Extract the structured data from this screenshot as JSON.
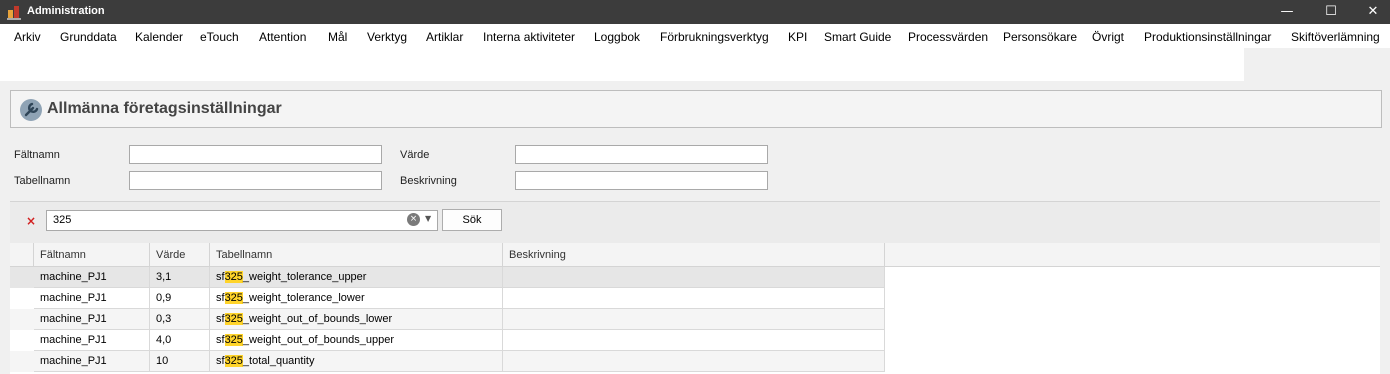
{
  "window": {
    "title": "Administration",
    "minimize_glyph": "—",
    "maximize_glyph": "☐",
    "close_glyph": "✕"
  },
  "menu": [
    "Arkiv",
    "Grunddata",
    "Kalender",
    "eTouch",
    "Attention",
    "Mål",
    "Verktyg",
    "Artiklar",
    "Interna aktiviteter",
    "Loggbok",
    "Förbrukningsverktyg",
    "KPI",
    "Smart Guide",
    "Processvärden",
    "Personsökare",
    "Övrigt",
    "Produktionsinställningar",
    "Skiftöverlämning"
  ],
  "panel": {
    "title": "Allmänna företagsinställningar",
    "icon": "wrench-icon"
  },
  "filters": {
    "faltnamn_label": "Fältnamn",
    "faltnamn_value": "",
    "varde_label": "Värde",
    "varde_value": "",
    "tabellnamn_label": "Tabellnamn",
    "tabellnamn_value": "",
    "beskrivning_label": "Beskrivning",
    "beskrivning_value": ""
  },
  "search": {
    "value": "325",
    "button_label": "Sök",
    "clear_glyph": "×"
  },
  "grid": {
    "columns": [
      "Fältnamn",
      "Värde",
      "Tabellnamn",
      "Beskrivning"
    ],
    "highlight": "325",
    "row_indicator": "→",
    "rows": [
      {
        "faltnamn": "machine_PJ1",
        "varde": "3,1",
        "tabellnamn_pre": "sf",
        "tabellnamn_post": "_weight_tolerance_upper",
        "beskrivning": ""
      },
      {
        "faltnamn": "machine_PJ1",
        "varde": "0,9",
        "tabellnamn_pre": "sf",
        "tabellnamn_post": "_weight_tolerance_lower",
        "beskrivning": ""
      },
      {
        "faltnamn": "machine_PJ1",
        "varde": "0,3",
        "tabellnamn_pre": "sf",
        "tabellnamn_post": "_weight_out_of_bounds_lower",
        "beskrivning": ""
      },
      {
        "faltnamn": "machine_PJ1",
        "varde": "4,0",
        "tabellnamn_pre": "sf",
        "tabellnamn_post": "_weight_out_of_bounds_upper",
        "beskrivning": ""
      },
      {
        "faltnamn": "machine_PJ1",
        "varde": "10",
        "tabellnamn_pre": "sf",
        "tabellnamn_post": "_total_quantity",
        "beskrivning": ""
      }
    ]
  },
  "colors": {
    "titlebar": "#3c3c3c",
    "highlight": "#ffd42a",
    "selected_row": "#e6e6e6",
    "clear": "#d21f1f"
  }
}
